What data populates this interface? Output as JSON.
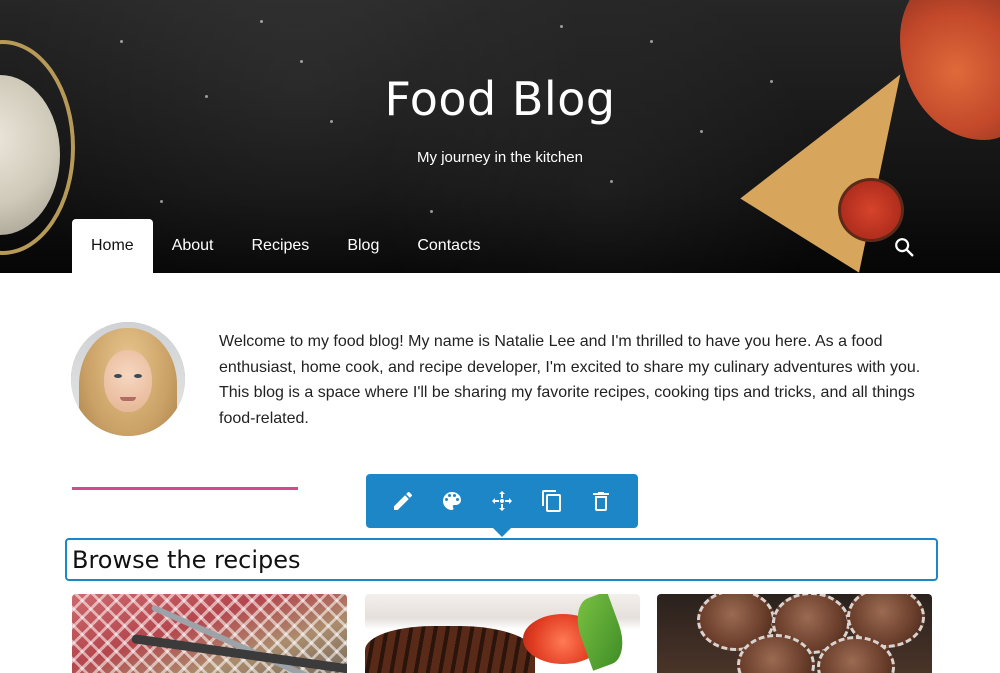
{
  "hero": {
    "title": "Food Blog",
    "subtitle": "My journey in the kitchen"
  },
  "nav": {
    "items": [
      {
        "label": "Home",
        "active": true
      },
      {
        "label": "About",
        "active": false
      },
      {
        "label": "Recipes",
        "active": false
      },
      {
        "label": "Blog",
        "active": false
      },
      {
        "label": "Contacts",
        "active": false
      }
    ],
    "search_icon": "search-icon"
  },
  "intro": {
    "text": "Welcome to my food blog! My name is Natalie Lee and I'm thrilled to have you here. As a food enthusiast, home cook, and recipe developer, I'm excited to share my culinary adventures with you. This blog is a space where I'll be sharing my favorite recipes, cooking tips and tricks, and all things food-related."
  },
  "toolbar": {
    "icons": [
      "pencil-icon",
      "palette-icon",
      "move-icon",
      "duplicate-icon",
      "trash-icon"
    ]
  },
  "section": {
    "heading": "Browse the recipes"
  },
  "colors": {
    "accent": "#1c86c7",
    "divider": "#d4488c"
  }
}
